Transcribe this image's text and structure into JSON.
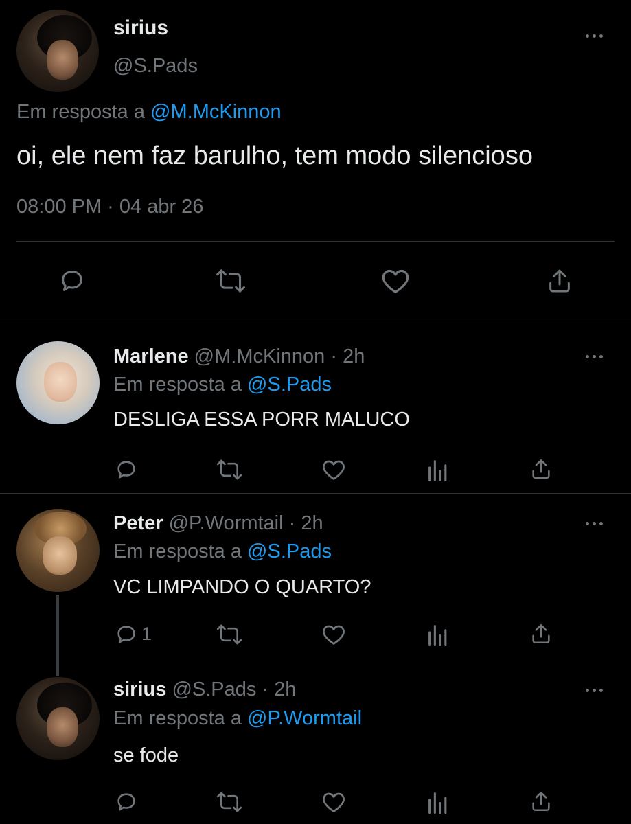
{
  "main_tweet": {
    "author_name": "sirius",
    "author_handle": "@S.Pads",
    "reply_prefix": "Em resposta a",
    "reply_to": "@M.McKinnon",
    "text": "oi, ele nem faz barulho, tem modo silencioso",
    "timestamp": "08:00 PM · 04 abr 26",
    "actions": [
      "reply-icon",
      "retweet-icon",
      "like-icon",
      "share-icon"
    ]
  },
  "replies": [
    {
      "author_name": "Marlene",
      "author_handle": "@M.McKinnon",
      "time": "· 2h",
      "reply_prefix": "Em resposta a",
      "reply_to": "@S.Pads",
      "text": "DESLIGA ESSA PORR MALUCO",
      "reply_count": ""
    },
    {
      "author_name": "Peter",
      "author_handle": "@P.Wormtail",
      "time": "· 2h",
      "reply_prefix": "Em resposta a",
      "reply_to": "@S.Pads",
      "text": "VC LIMPANDO O QUARTO?",
      "reply_count": "1"
    },
    {
      "author_name": "sirius",
      "author_handle": "@S.Pads",
      "time": "· 2h",
      "reply_prefix": "Em resposta a",
      "reply_to": "@P.Wormtail",
      "text": "se fode",
      "reply_count": ""
    }
  ],
  "colors": {
    "background": "#000000",
    "text": "#e7e9ea",
    "secondary": "#71767b",
    "link": "#1d9bf0",
    "divider": "#2f3336"
  }
}
